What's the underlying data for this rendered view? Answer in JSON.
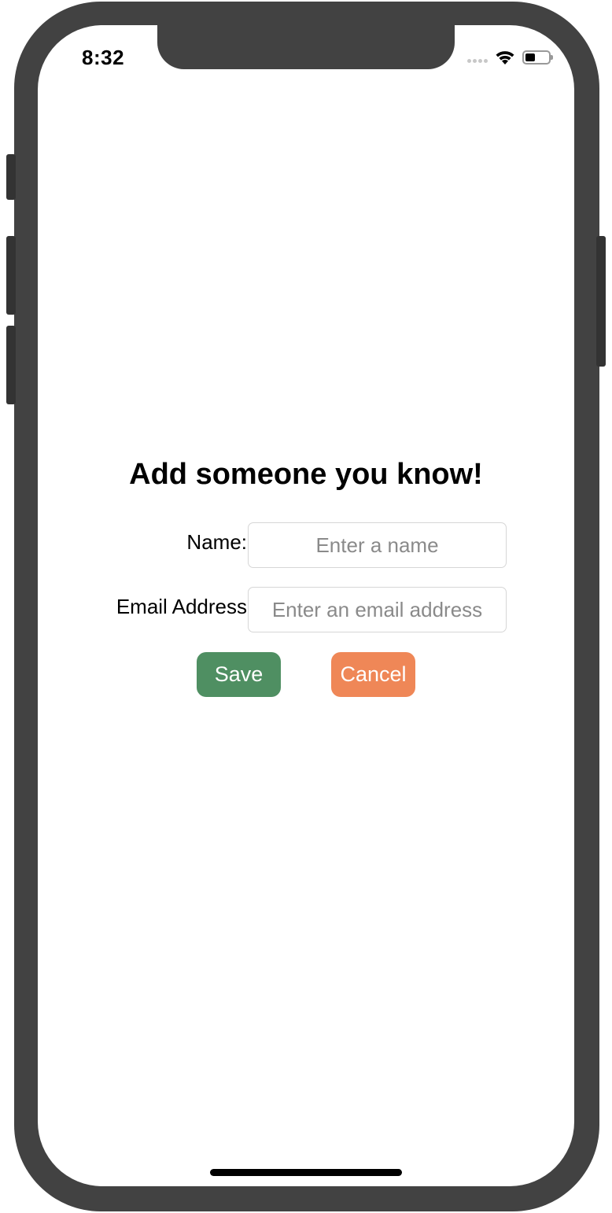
{
  "status_bar": {
    "time": "8:32",
    "icons": [
      "cellular-signal-icon",
      "wifi-icon",
      "battery-icon"
    ]
  },
  "form": {
    "title": "Add someone you know!",
    "name_label": "Name:",
    "name_placeholder": "Enter a name",
    "name_value": "",
    "email_label": "Email Address",
    "email_placeholder": "Enter an email address",
    "email_value": "",
    "save_label": "Save",
    "cancel_label": "Cancel"
  },
  "colors": {
    "save_button": "#4f8f62",
    "cancel_button": "#ef8757",
    "device_frame": "#424242"
  }
}
